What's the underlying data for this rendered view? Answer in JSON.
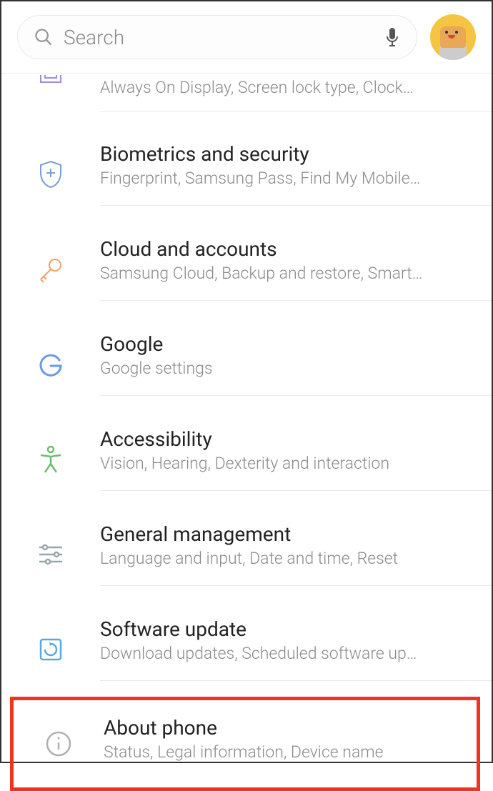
{
  "search": {
    "placeholder": "Search"
  },
  "items": [
    {
      "title": "",
      "subtitle": "Always On Display, Screen lock type, Clock…"
    },
    {
      "title": "Biometrics and security",
      "subtitle": "Fingerprint, Samsung Pass, Find My Mobile…"
    },
    {
      "title": "Cloud and accounts",
      "subtitle": "Samsung Cloud, Backup and restore, Smart…"
    },
    {
      "title": "Google",
      "subtitle": "Google settings"
    },
    {
      "title": "Accessibility",
      "subtitle": "Vision, Hearing, Dexterity and interaction"
    },
    {
      "title": "General management",
      "subtitle": "Language and input, Date and time, Reset"
    },
    {
      "title": "Software update",
      "subtitle": "Download updates, Scheduled software up…"
    },
    {
      "title": "About phone",
      "subtitle": "Status, Legal information, Device name"
    }
  ],
  "colors": {
    "lockscreen": "#a18be0",
    "biometrics": "#7aa0d4",
    "cloud": "#f0a16b",
    "google": "#6a9ae8",
    "accessibility": "#7fc97f",
    "general": "#9aa5ab",
    "software": "#5aa8e0",
    "about": "#b0b0b0",
    "highlight": "#e32"
  }
}
